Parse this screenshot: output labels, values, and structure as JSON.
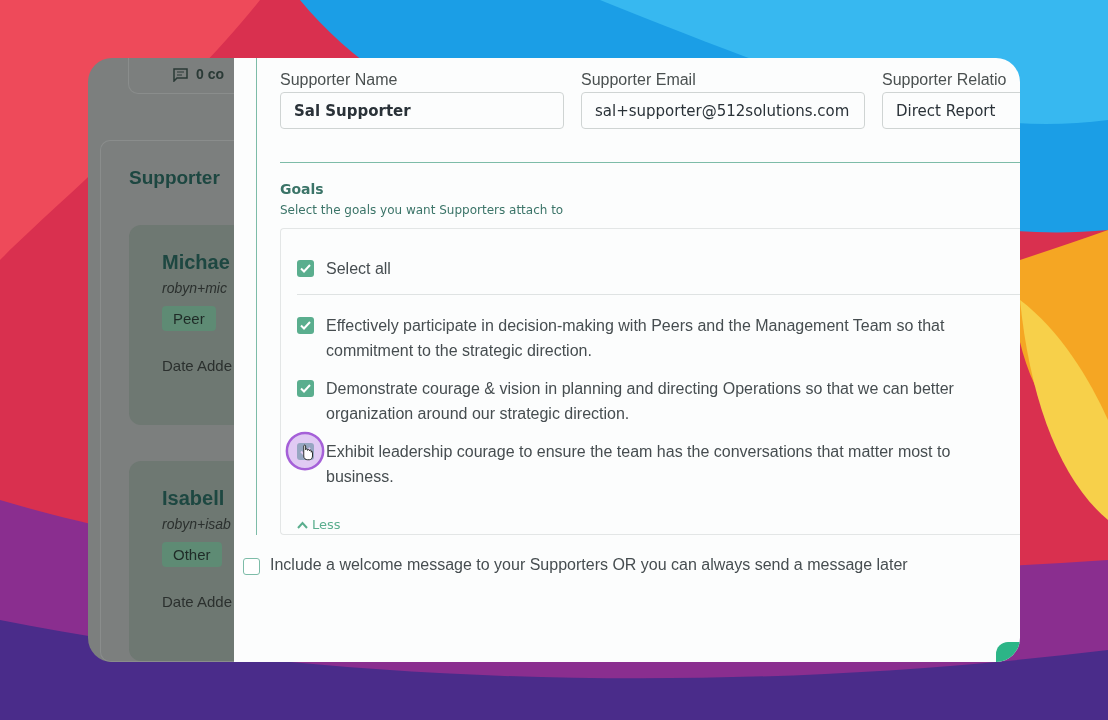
{
  "background_page": {
    "comments": "0 co",
    "section_title": "Supporter",
    "cards": [
      {
        "name": "Michae",
        "email": "robyn+mic",
        "relationship": "Peer",
        "date_label": "Date Adde"
      },
      {
        "name": "Isabell",
        "email": "robyn+isab",
        "relationship": "Other",
        "date_label": "Date Adde"
      }
    ]
  },
  "form": {
    "fields": [
      {
        "kind": "name",
        "label": "Supporter Name",
        "value": "Sal Supporter"
      },
      {
        "kind": "email",
        "label": "Supporter Email",
        "value": "sal+supporter@512solutions.com"
      },
      {
        "kind": "select",
        "label": "Supporter Relatio",
        "value": "Direct Report"
      }
    ],
    "goals": {
      "title": "Goals",
      "subtitle": "Select the goals you want Supporters attach to",
      "select_all": {
        "label": "Select all",
        "checked": true
      },
      "items": [
        {
          "lines": [
            "Effectively participate in decision-making with Peers and the Management Team so that",
            "commitment to the strategic direction."
          ],
          "checked": true
        },
        {
          "lines": [
            "Demonstrate courage & vision in planning and directing Operations so that we can better",
            "organization around our strategic direction."
          ],
          "checked": true
        },
        {
          "lines": [
            "Exhibit leadership courage to ensure the team has the conversations that matter most to",
            "business."
          ],
          "checked": true
        }
      ],
      "toggle": "Less"
    },
    "welcome": {
      "label": "Include a welcome message to your Supporters OR you can always send a message later",
      "checked": false
    }
  }
}
